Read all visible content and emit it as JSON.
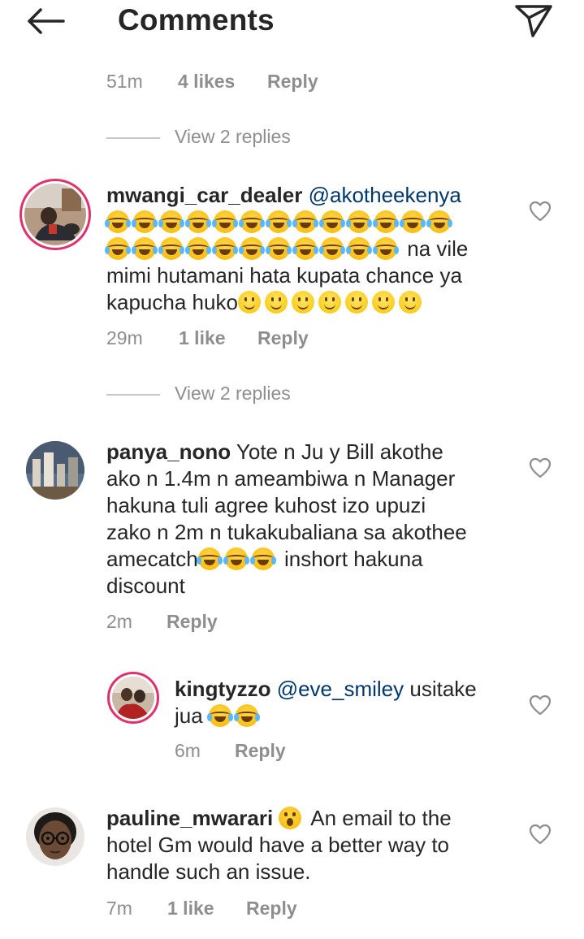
{
  "header": {
    "title": "Comments",
    "back_icon": "arrow-left-icon",
    "send_icon": "paper-plane-icon"
  },
  "top_meta": {
    "time": "51m",
    "likes": "4 likes",
    "reply": "Reply"
  },
  "view_replies_1": "View 2 replies",
  "comments": [
    {
      "username": "mwangi_car_dealer",
      "mention": "@akotheekenya",
      "line2_text": "na vile",
      "line3": "mimi hutamani hata kupata chance ya",
      "line4_text": "kapucha huko",
      "time": "29m",
      "likes": "1 like",
      "reply": "Reply"
    },
    {
      "username": "panya_nono",
      "line1": "Yote n Ju y Bill akothe",
      "line2": "ako n 1.4m n ameambiwa n Manager",
      "line3": "hakuna tuli agree kuhost izo upuzi",
      "line4": "zako n 2m n tukakubaliana sa akothee",
      "line5a": "amecatch",
      "line5b": "inshort hakuna",
      "line6": "discount",
      "time": "2m",
      "reply": "Reply"
    },
    {
      "username": "kingtyzzo",
      "mention": "@eve_smiley",
      "line1_text": "usitake",
      "line2_text": "jua",
      "time": "6m",
      "reply": "Reply"
    },
    {
      "username": "pauline_mwarari",
      "line1_text": "An email to the",
      "line2": "hotel Gm would have a better way to",
      "line3": "handle such an issue.",
      "time": "7m",
      "likes": "1 like",
      "reply": "Reply"
    }
  ],
  "view_replies_2": "View 2 replies",
  "colors": {
    "text": "#262626",
    "muted": "#8e8e8e",
    "mention": "#00376b",
    "story_ring": "#e1306c"
  }
}
